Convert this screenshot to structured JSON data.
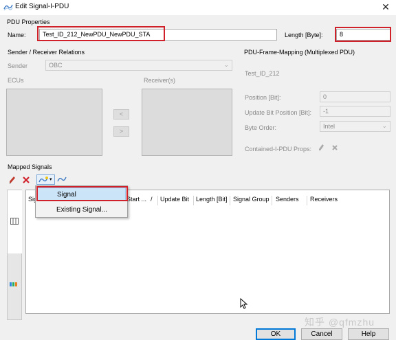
{
  "window": {
    "title": "Edit Signal-I-PDU",
    "close_glyph": "✕"
  },
  "pdu_properties": {
    "section": "PDU Properties",
    "name_label": "Name:",
    "name_value": "Test_ID_212_NewPDU_NewPDU_STA",
    "length_label": "Length [Byte]:",
    "length_value": "8"
  },
  "sender_receiver": {
    "section": "Sender / Receiver Relations",
    "sender_label": "Sender",
    "sender_value": "OBC",
    "ecus_label": "ECUs",
    "receivers_label": "Receiver(s)",
    "move_left": "<",
    "move_right": ">"
  },
  "frame_mapping": {
    "section": "PDU-Frame-Mapping (Multiplexed PDU)",
    "pdu_name": "Test_ID_212",
    "position_label": "Position [Bit]:",
    "position_value": "0",
    "update_bit_label": "Update Bit Position [Bit]:",
    "update_bit_value": "-1",
    "byte_order_label": "Byte Order:",
    "byte_order_value": "Intel",
    "contained_label": "Contained-I-PDU Props:"
  },
  "mapped_signals": {
    "section": "Mapped Signals",
    "columns": [
      "Sig",
      "Start ...",
      "Update Bit",
      "Length [Bit]",
      "Signal Group",
      "Senders",
      "Receivers"
    ],
    "sort_glyph": "/",
    "menu": [
      "Signal",
      "Existing Signal..."
    ]
  },
  "buttons": {
    "ok": "OK",
    "cancel": "Cancel",
    "help": "Help"
  },
  "watermark": "知乎 @qfmzhu",
  "colors": {
    "highlight_red": "#d0202a",
    "menu_highlight": "#cce4f7",
    "dialog_bg": "#f0f0f0"
  }
}
